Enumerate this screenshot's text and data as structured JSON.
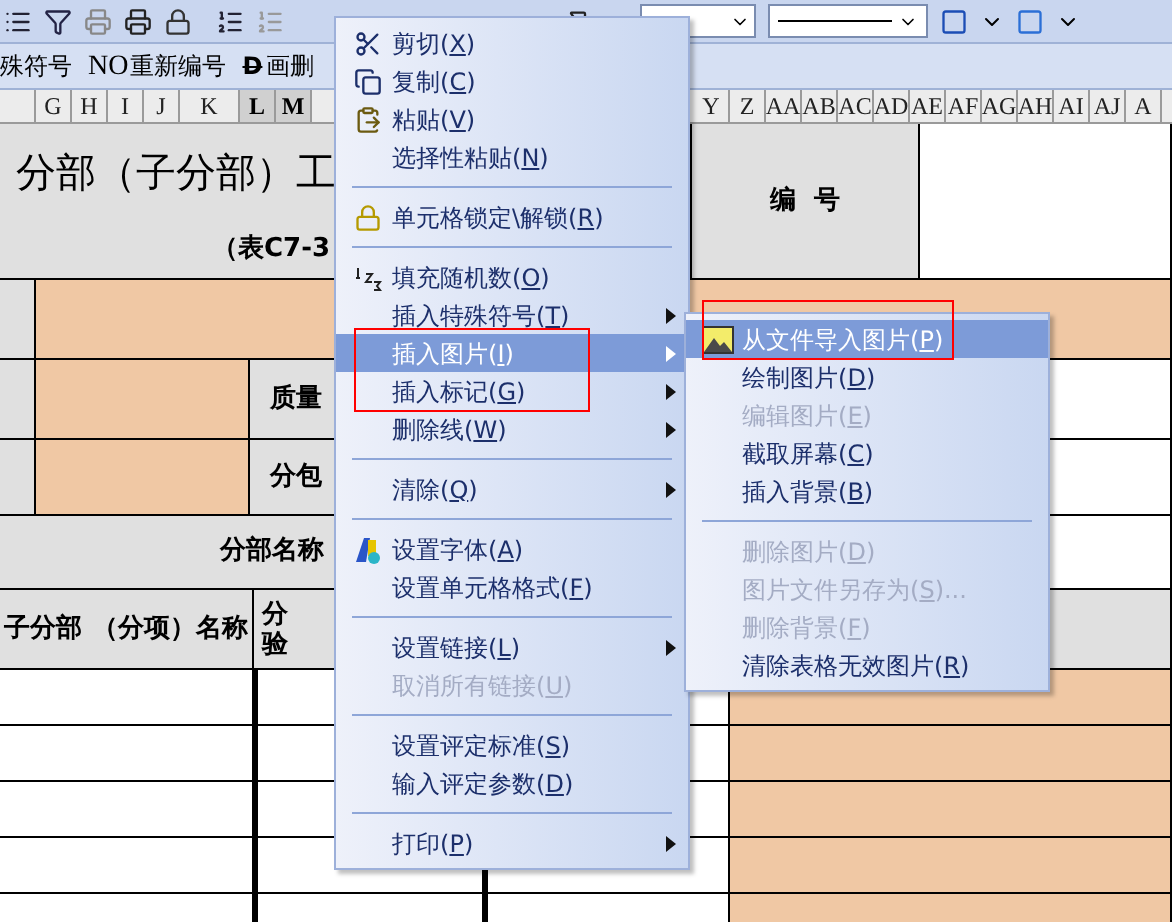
{
  "format_bar": [
    {
      "kind": "plain",
      "label": "殊符号"
    },
    {
      "kind": "numbered",
      "prefix": "NO",
      "label": "重新编号"
    },
    {
      "kind": "struck",
      "prefix": "D",
      "label": "画删"
    }
  ],
  "column_headers_left": [
    {
      "label": "G",
      "selected": false
    },
    {
      "label": "H",
      "selected": false
    },
    {
      "label": "I",
      "selected": false
    },
    {
      "label": "J",
      "selected": false
    },
    {
      "label": "K",
      "selected": false
    },
    {
      "label": "L",
      "selected": true
    },
    {
      "label": "M",
      "selected": true
    }
  ],
  "column_headers_right": [
    {
      "label": "Y",
      "selected": false
    },
    {
      "label": "Z",
      "selected": false
    },
    {
      "label": "AA",
      "selected": false
    },
    {
      "label": "AB",
      "selected": false
    },
    {
      "label": "AC",
      "selected": false
    },
    {
      "label": "AD",
      "selected": false
    },
    {
      "label": "AE",
      "selected": false
    },
    {
      "label": "AF",
      "selected": false
    },
    {
      "label": "AG",
      "selected": false
    },
    {
      "label": "AH",
      "selected": false
    },
    {
      "label": "AI",
      "selected": false
    },
    {
      "label": "AJ",
      "selected": false
    },
    {
      "label": "A",
      "selected": false
    }
  ],
  "sheet": {
    "title": "分部（子分部）工",
    "subtitle": "（表C7-3",
    "code_label": "编  号",
    "quality_label": "质量",
    "subcontract_label": "分包",
    "section_name_label": "分部名称",
    "sub_header": [
      "子分部",
      "（分项）名称"
    ],
    "column_2_header": [
      "分",
      "验"
    ]
  },
  "context_menu": [
    {
      "kind": "item",
      "label": "剪切(X)",
      "disabled": false,
      "submenu": false,
      "selected": false
    },
    {
      "kind": "item",
      "label": "复制(C)",
      "disabled": false,
      "submenu": false,
      "selected": false
    },
    {
      "kind": "item",
      "label": "粘贴(V)",
      "disabled": false,
      "submenu": false,
      "selected": false
    },
    {
      "kind": "item",
      "label": "选择性粘贴(N)",
      "disabled": false,
      "submenu": false,
      "selected": false
    },
    {
      "kind": "separator"
    },
    {
      "kind": "item",
      "label": "单元格锁定\\解锁(R)",
      "disabled": false,
      "submenu": false,
      "selected": false
    },
    {
      "kind": "separator"
    },
    {
      "kind": "item",
      "label": "填充随机数(O)",
      "disabled": false,
      "submenu": false,
      "selected": false
    },
    {
      "kind": "item",
      "label": "插入特殊符号(T)",
      "disabled": false,
      "submenu": true,
      "selected": false
    },
    {
      "kind": "item",
      "label": "插入图片(I)",
      "disabled": false,
      "submenu": true,
      "selected": true
    },
    {
      "kind": "item",
      "label": "插入标记(G)",
      "disabled": false,
      "submenu": true,
      "selected": false
    },
    {
      "kind": "item",
      "label": "删除线(W)",
      "disabled": false,
      "submenu": true,
      "selected": false
    },
    {
      "kind": "separator"
    },
    {
      "kind": "item",
      "label": "清除(Q)",
      "disabled": false,
      "submenu": true,
      "selected": false
    },
    {
      "kind": "separator"
    },
    {
      "kind": "item",
      "label": "设置字体(A)",
      "disabled": false,
      "submenu": false,
      "selected": false
    },
    {
      "kind": "item",
      "label": "设置单元格格式(F)",
      "disabled": false,
      "submenu": false,
      "selected": false
    },
    {
      "kind": "separator"
    },
    {
      "kind": "item",
      "label": "设置链接(L)",
      "disabled": false,
      "submenu": true,
      "selected": false
    },
    {
      "kind": "item",
      "label": "取消所有链接(U)",
      "disabled": true,
      "submenu": false,
      "selected": false
    },
    {
      "kind": "separator"
    },
    {
      "kind": "item",
      "label": "设置评定标准(S)",
      "disabled": false,
      "submenu": false,
      "selected": false
    },
    {
      "kind": "item",
      "label": "输入评定参数(D)",
      "disabled": false,
      "submenu": false,
      "selected": false
    },
    {
      "kind": "separator"
    },
    {
      "kind": "item",
      "label": "打印(P)",
      "disabled": false,
      "submenu": true,
      "selected": false
    }
  ],
  "picture_submenu": [
    {
      "kind": "item",
      "label": "从文件导入图片(P)",
      "disabled": false,
      "selected": true
    },
    {
      "kind": "item",
      "label": "绘制图片(D)",
      "disabled": false,
      "selected": false
    },
    {
      "kind": "item",
      "label": "编辑图片(E)",
      "disabled": true,
      "selected": false
    },
    {
      "kind": "item",
      "label": "截取屏幕(C)",
      "disabled": false,
      "selected": false
    },
    {
      "kind": "item",
      "label": "插入背景(B)",
      "disabled": false,
      "selected": false
    },
    {
      "kind": "separator"
    },
    {
      "kind": "item",
      "label": "删除图片(D)",
      "disabled": true,
      "selected": false
    },
    {
      "kind": "item",
      "label": "图片文件另存为(S)...",
      "disabled": true,
      "selected": false
    },
    {
      "kind": "item",
      "label": "删除背景(F)",
      "disabled": true,
      "selected": false
    },
    {
      "kind": "item",
      "label": "清除表格无效图片(R)",
      "disabled": false,
      "selected": false
    }
  ]
}
